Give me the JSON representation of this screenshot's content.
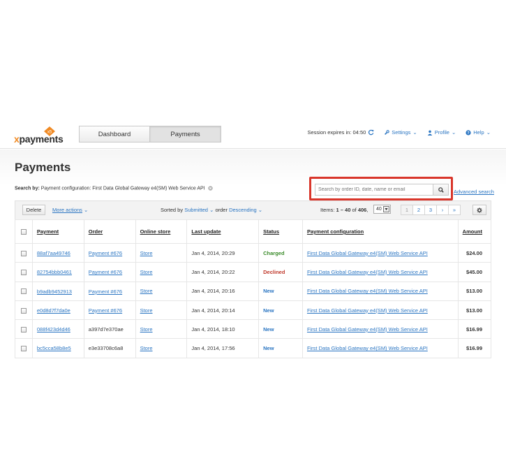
{
  "header": {
    "logo_text": "xpayments",
    "logo_badge": "x5",
    "tabs": [
      {
        "label": "Dashboard",
        "active": false
      },
      {
        "label": "Payments",
        "active": true
      }
    ],
    "session_label": "Session expires in: 04:50",
    "settings_label": "Settings",
    "profile_label": "Profile",
    "help_label": "Help"
  },
  "page": {
    "title": "Payments",
    "search_by_label": "Search by:",
    "search_by_value": "Payment configuration: First Data Global Gateway e4(SM) Web Service API",
    "search_placeholder": "Search by order ID, date, name or email",
    "advanced_search": "Advanced search"
  },
  "toolbar": {
    "delete_label": "Delete",
    "more_actions_label": "More actions",
    "sorted_prefix": "Sorted by",
    "sorted_field": "Submitted",
    "order_prefix": "order",
    "order_value": "Descending",
    "items_prefix": "Items:",
    "items_range": "1 – 40",
    "items_of": "of",
    "items_total": "406",
    "per_page": "40",
    "pages": [
      "1",
      "2",
      "3",
      "›",
      "»"
    ]
  },
  "table": {
    "headers": [
      "Payment",
      "Order",
      "Online store",
      "Last update",
      "Status",
      "Payment configuration",
      "Amount"
    ],
    "rows": [
      {
        "payment": "88af7aa49746",
        "order": "Payment #676",
        "order_link": true,
        "store": "Store",
        "updated": "Jan 4, 2014, 20:29",
        "status": "Charged",
        "status_type": "charged",
        "config": "First Data Global Gateway e4(SM) Web Service API",
        "amount": "$24.00"
      },
      {
        "payment": "82754bbb0461",
        "order": "Payment #676",
        "order_link": true,
        "store": "Store",
        "updated": "Jan 4, 2014, 20:22",
        "status": "Declined",
        "status_type": "declined",
        "config": "First Data Global Gateway e4(SM) Web Service API",
        "amount": "$45.00"
      },
      {
        "payment": "b9adb9452913",
        "order": "Payment #676",
        "order_link": true,
        "store": "Store",
        "updated": "Jan 4, 2014, 20:16",
        "status": "New",
        "status_type": "new",
        "config": "First Data Global Gateway e4(SM) Web Service API",
        "amount": "$13.00"
      },
      {
        "payment": "e0d8d7f7da0e",
        "order": "Payment #676",
        "order_link": true,
        "store": "Store",
        "updated": "Jan 4, 2014, 20:14",
        "status": "New",
        "status_type": "new",
        "config": "First Data Global Gateway e4(SM) Web Service API",
        "amount": "$13.00"
      },
      {
        "payment": "088f423d4d46",
        "order": "a397d7e370ae",
        "order_link": false,
        "store": "Store",
        "updated": "Jan 4, 2014, 18:10",
        "status": "New",
        "status_type": "new",
        "config": "First Data Global Gateway e4(SM) Web Service API",
        "amount": "$16.99"
      },
      {
        "payment": "bc5cca58b8e5",
        "order": "e3e33708c6a8",
        "order_link": false,
        "store": "Store",
        "updated": "Jan 4, 2014, 17:56",
        "status": "New",
        "status_type": "new",
        "config": "First Data Global Gateway e4(SM) Web Service API",
        "amount": "$16.99"
      }
    ]
  },
  "colors": {
    "link": "#2a75c2",
    "charged": "#3a8b2a",
    "declined": "#c0392b",
    "highlight": "#d9362b",
    "logo_orange": "#f08a24"
  },
  "icons": [
    "refresh-icon",
    "wrench-icon",
    "user-icon",
    "help-icon",
    "search-icon",
    "gear-icon",
    "chevron-down-icon"
  ]
}
